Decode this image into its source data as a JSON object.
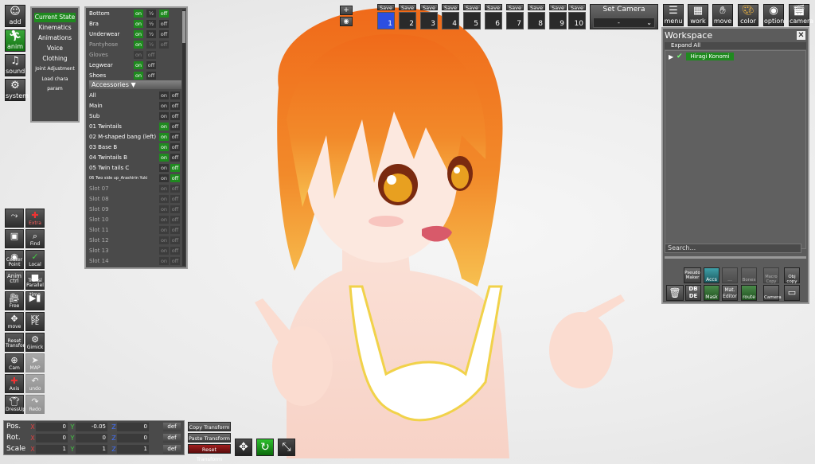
{
  "main_menu": [
    {
      "label": "add",
      "icon": "person-add-icon"
    },
    {
      "label": "anim",
      "icon": "running-figure-icon"
    },
    {
      "label": "sound",
      "icon": "music-note-icon"
    },
    {
      "label": "system",
      "icon": "gears-icon"
    }
  ],
  "categories": [
    "Current State",
    "Kinematics",
    "Animations",
    "Voice",
    "Clothing",
    "Joint Adjustment",
    "Load chara param"
  ],
  "clothing_rows": [
    {
      "name": "Bottom",
      "a": "on",
      "b": "½",
      "c": "off"
    },
    {
      "name": "Bra",
      "a": "on",
      "b": "½",
      "c": "off"
    },
    {
      "name": "Underwear",
      "a": "on",
      "b": "½",
      "c": "off"
    },
    {
      "name": "Pantyhose",
      "a": "on",
      "b": "½",
      "c": "off"
    },
    {
      "name": "Gloves",
      "a": "on",
      "b": "off"
    },
    {
      "name": "Legwear",
      "a": "on",
      "b": "off"
    },
    {
      "name": "Shoes",
      "a": "on",
      "b": "off"
    }
  ],
  "accessories_header": "Accessories",
  "accessory_rows": [
    {
      "name": "All",
      "a": "on",
      "b": "off"
    },
    {
      "name": "Main",
      "a": "on",
      "b": "off"
    },
    {
      "name": "Sub",
      "a": "on",
      "b": "off"
    },
    {
      "name": "01 Twintails",
      "a": "on",
      "b": "off"
    },
    {
      "name": "02 M-shaped bang (left)",
      "a": "on",
      "b": "off"
    },
    {
      "name": "03 Base B",
      "a": "on",
      "b": "off"
    },
    {
      "name": "04 Twintails B",
      "a": "on",
      "b": "off"
    },
    {
      "name": "05 Twin tails C",
      "a": "on",
      "b": "off"
    },
    {
      "name": "06 Two side up_Arashirin Yuki",
      "a": "on",
      "b": "off"
    },
    {
      "name": "Slot 07",
      "a": "on",
      "b": "off"
    },
    {
      "name": "Slot 08",
      "a": "on",
      "b": "off"
    },
    {
      "name": "Slot 09",
      "a": "on",
      "b": "off"
    },
    {
      "name": "Slot 10",
      "a": "on",
      "b": "off"
    },
    {
      "name": "Slot 11",
      "a": "on",
      "b": "off"
    },
    {
      "name": "Slot 12",
      "a": "on",
      "b": "off"
    },
    {
      "name": "Slot 13",
      "a": "on",
      "b": "off"
    },
    {
      "name": "Slot 14",
      "a": "on",
      "b": "off"
    }
  ],
  "left_tools": [
    {
      "label": "",
      "icon": "running-pose-icon"
    },
    {
      "label": "Extra",
      "icon": "axis-icon"
    },
    {
      "label": "",
      "icon": "save-disk-icon"
    },
    {
      "label": "Find",
      "icon": "magnifier-icon"
    },
    {
      "label": "Center Point",
      "icon": "target-icon"
    },
    {
      "label": "Local",
      "icon": "local-axis-icon"
    },
    {
      "label": "Anim ctrl",
      "icon": ""
    },
    {
      "label": "Transl Parallel",
      "icon": "square-icon"
    },
    {
      "label": "Free",
      "icon": "camera-free-icon"
    },
    {
      "label": "time",
      "icon": "play-pause-icon"
    },
    {
      "label": "move",
      "icon": "move-arrows-icon"
    },
    {
      "label": "KK PE",
      "icon": ""
    },
    {
      "label": "Reset Transform",
      "icon": ""
    },
    {
      "label": "Gimick",
      "icon": "gear-icon"
    },
    {
      "label": "Cam",
      "icon": "plus-circle-icon"
    },
    {
      "label": "MAP",
      "icon": "map-pin-icon"
    },
    {
      "label": "Axis",
      "icon": "xyz-axis-icon"
    },
    {
      "label": "undo",
      "icon": "undo-icon"
    },
    {
      "label": "DressUp",
      "icon": "shirt-icon"
    },
    {
      "label": "Redo",
      "icon": "redo-icon"
    }
  ],
  "save_slots": [
    {
      "label": "Save",
      "num": "1"
    },
    {
      "label": "Save",
      "num": "2"
    },
    {
      "label": "Save",
      "num": "3"
    },
    {
      "label": "Save",
      "num": "4"
    },
    {
      "label": "Save",
      "num": "5"
    },
    {
      "label": "Save",
      "num": "6"
    },
    {
      "label": "Save",
      "num": "7"
    },
    {
      "label": "Save",
      "num": "8"
    },
    {
      "label": "Save",
      "num": "9"
    },
    {
      "label": "Save",
      "num": "10"
    }
  ],
  "camera": {
    "title": "Set Camera",
    "selected": "-"
  },
  "top_right": [
    {
      "label": "menu",
      "icon": "menu-lines-icon"
    },
    {
      "label": "work",
      "icon": "workspace-icon"
    },
    {
      "label": "move",
      "icon": "hand-icon"
    },
    {
      "label": "color",
      "icon": "palette-icon"
    },
    {
      "label": "option",
      "icon": "eye-icon"
    },
    {
      "label": "camera",
      "icon": "clapper-icon"
    }
  ],
  "workspace": {
    "title": "Workspace",
    "expand": "Expand All",
    "item": "Hiragi Konomi",
    "search_placeholder": "Search...",
    "buttons_row1": [
      {
        "label": "Pseudo Maker"
      },
      {
        "label": "Accs"
      },
      {
        "label": "..."
      },
      {
        "label": "Bones"
      },
      {
        "label": "Macro Copy"
      },
      {
        "label": "Obj copy"
      }
    ],
    "buttons_row2": [
      {
        "label": ""
      },
      {
        "label": "DB DE"
      },
      {
        "label": "Mask"
      },
      {
        "label": "Mat. Editor"
      },
      {
        "label": "route"
      },
      {
        "label": "Camera"
      },
      {
        "label": ""
      }
    ]
  },
  "transform": {
    "rows": [
      {
        "label": "Pos.",
        "x": "0",
        "y": "-0.05",
        "z": "0"
      },
      {
        "label": "Rot.",
        "x": "0",
        "y": "0",
        "z": "0"
      },
      {
        "label": "Scale",
        "x": "1",
        "y": "1",
        "z": "1"
      }
    ],
    "def": "def",
    "axes": [
      "X",
      "Y",
      "Z"
    ],
    "copy": "Copy Transform",
    "paste": "Paste Transform",
    "reset": "Reset Transform"
  },
  "colors": {
    "accent_green": "#1f8a1f",
    "save_selected": "#2c4fe0",
    "reset_red": "#8a1a1a"
  }
}
